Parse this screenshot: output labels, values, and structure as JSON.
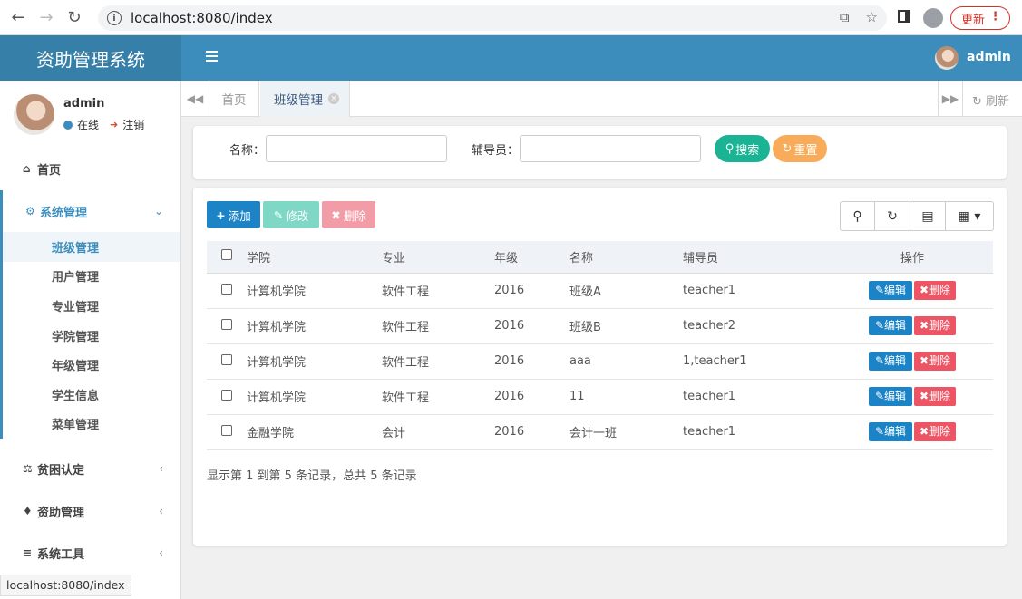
{
  "browser": {
    "url": "localhost:8080/index",
    "update_label": "更新",
    "status_url": "localhost:8080/index"
  },
  "header": {
    "brand": "资助管理系统",
    "user": "admin"
  },
  "sidebar": {
    "user_name": "admin",
    "online_label": "在线",
    "logout_label": "注销",
    "menu": [
      {
        "label": "首页",
        "icon": "home-icon"
      },
      {
        "label": "系统管理",
        "icon": "gear-icon"
      },
      {
        "label": "贫困认定",
        "icon": "balance-scale-icon"
      },
      {
        "label": "资助管理",
        "icon": "bell-icon"
      },
      {
        "label": "系统工具",
        "icon": "bars-icon"
      }
    ],
    "submenu": [
      "班级管理",
      "用户管理",
      "专业管理",
      "学院管理",
      "年级管理",
      "学生信息",
      "菜单管理"
    ]
  },
  "tabs": {
    "home": "首页",
    "current": "班级管理",
    "refresh": "刷新"
  },
  "search": {
    "name_label": "名称：",
    "counselor_label": "辅导员：",
    "search_btn": "搜索",
    "reset_btn": "重置"
  },
  "toolbar": {
    "add": "添加",
    "edit": "修改",
    "delete": "删除"
  },
  "table": {
    "headers": [
      "学院",
      "专业",
      "年级",
      "名称",
      "辅导员",
      "操作"
    ],
    "rows": [
      [
        "计算机学院",
        "软件工程",
        "2016",
        "班级A",
        "teacher1"
      ],
      [
        "计算机学院",
        "软件工程",
        "2016",
        "班级B",
        "teacher2"
      ],
      [
        "计算机学院",
        "软件工程",
        "2016",
        "aaa",
        "1,teacher1"
      ],
      [
        "计算机学院",
        "软件工程",
        "2016",
        "11",
        "teacher1"
      ],
      [
        "金融学院",
        "会计",
        "2016",
        "会计一班",
        "teacher1"
      ]
    ],
    "row_edit": "编辑",
    "row_delete": "删除",
    "summary": "显示第 1 到第 5 条记录，总共 5 条记录"
  },
  "colors": {
    "header_blue": "#3c8dbc",
    "brand_blue": "#367fa9",
    "primary": "#1c84c6",
    "success": "#1ab394",
    "warning": "#f8ac59",
    "danger": "#ed5565"
  }
}
